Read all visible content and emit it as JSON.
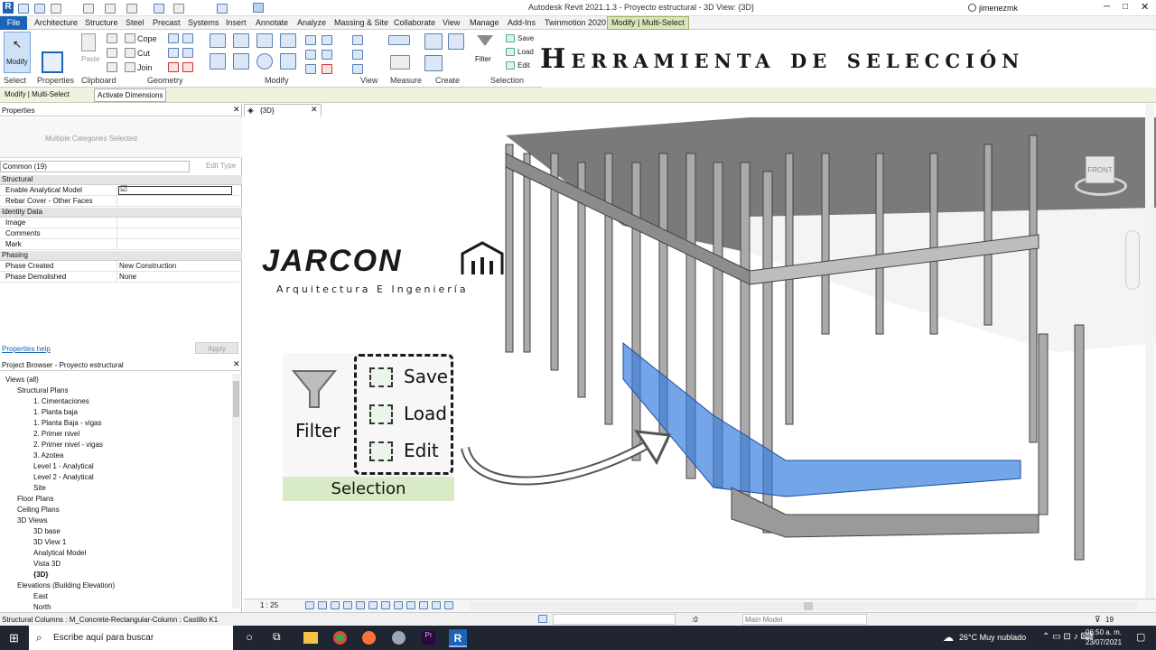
{
  "window": {
    "title": "Autodesk Revit 2021.1.3 - Proyecto estructural - 3D View: {3D}",
    "user": "jimenezmk"
  },
  "tabs": [
    "File",
    "Architecture",
    "Structure",
    "Steel",
    "Precast",
    "Systems",
    "Insert",
    "Annotate",
    "Analyze",
    "Massing & Site",
    "Collaborate",
    "View",
    "Manage",
    "Add-Ins",
    "Twinmotion 2020",
    "Modify | Multi-Select"
  ],
  "ribbon": {
    "modify": "Modify",
    "select": "Select",
    "properties": "Properties",
    "paste": "Paste",
    "clipboard": "Clipboard",
    "cope": "Cope",
    "cut": "Cut",
    "join": "Join",
    "geometry": "Geometry",
    "modify_group": "Modify",
    "view": "View",
    "measure": "Measure",
    "create": "Create",
    "filter": "Filter",
    "save": "Save",
    "load": "Load",
    "edit": "Edit",
    "selection": "Selection"
  },
  "context": {
    "label": "Modify | Multi-Select",
    "activate": "Activate Dimensions"
  },
  "banner": "Herramienta de selección",
  "properties": {
    "header": "Properties",
    "type": "Multiple Categories Selected",
    "filter": "Common (19)",
    "edit_type": "Edit Type",
    "sections": [
      {
        "name": "Structural",
        "rows": [
          {
            "k": "Enable Analytical Model",
            "v": ""
          },
          {
            "k": "Rebar Cover - Other Faces",
            "v": ""
          }
        ]
      },
      {
        "name": "Identity Data",
        "rows": [
          {
            "k": "Image",
            "v": ""
          },
          {
            "k": "Comments",
            "v": ""
          },
          {
            "k": "Mark",
            "v": ""
          }
        ]
      },
      {
        "name": "Phasing",
        "rows": [
          {
            "k": "Phase Created",
            "v": "New Construction"
          },
          {
            "k": "Phase Demolished",
            "v": "None"
          }
        ]
      }
    ],
    "help": "Properties help",
    "apply": "Apply"
  },
  "browser": {
    "header": "Project Browser - Proyecto estructural",
    "items": [
      {
        "t": "Views (all)",
        "l": 0
      },
      {
        "t": "Structural Plans",
        "l": 1
      },
      {
        "t": "1. Cimentaciones",
        "l": 2
      },
      {
        "t": "1. Planta baja",
        "l": 2
      },
      {
        "t": "1. Planta Baja - vigas",
        "l": 2
      },
      {
        "t": "2. Primer nivel",
        "l": 2
      },
      {
        "t": "2. Primer nivel - vigas",
        "l": 2
      },
      {
        "t": "3. Azotea",
        "l": 2
      },
      {
        "t": "Level 1 - Analytical",
        "l": 2
      },
      {
        "t": "Level 2 - Analytical",
        "l": 2
      },
      {
        "t": "Site",
        "l": 2
      },
      {
        "t": "Floor Plans",
        "l": 1
      },
      {
        "t": "Ceiling Plans",
        "l": 1
      },
      {
        "t": "3D Views",
        "l": 1
      },
      {
        "t": "3D base",
        "l": 2
      },
      {
        "t": "3D View 1",
        "l": 2
      },
      {
        "t": "Analytical Model",
        "l": 2
      },
      {
        "t": "Vista 3D",
        "l": 2
      },
      {
        "t": "{3D}",
        "l": 2
      },
      {
        "t": "Elevations (Building Elevation)",
        "l": 1
      },
      {
        "t": "East",
        "l": 2
      },
      {
        "t": "North",
        "l": 2
      }
    ]
  },
  "view": {
    "tab": "{3D}",
    "scale": "1 : 25",
    "cube": "FRONT"
  },
  "logo": {
    "name": "JARCON",
    "tagline": "Arquitectura E Ingeniería"
  },
  "status": {
    "text": "Structural Columns : M_Concrete-Rectangular-Column : Castillo K1",
    "model": "Main Model",
    "count": "19",
    "zero": ":0"
  },
  "taskbar": {
    "search": "Escribe aquí para buscar",
    "weather": "26°C  Muy nublado",
    "time": "06:50 a. m.",
    "date": "23/07/2021"
  }
}
